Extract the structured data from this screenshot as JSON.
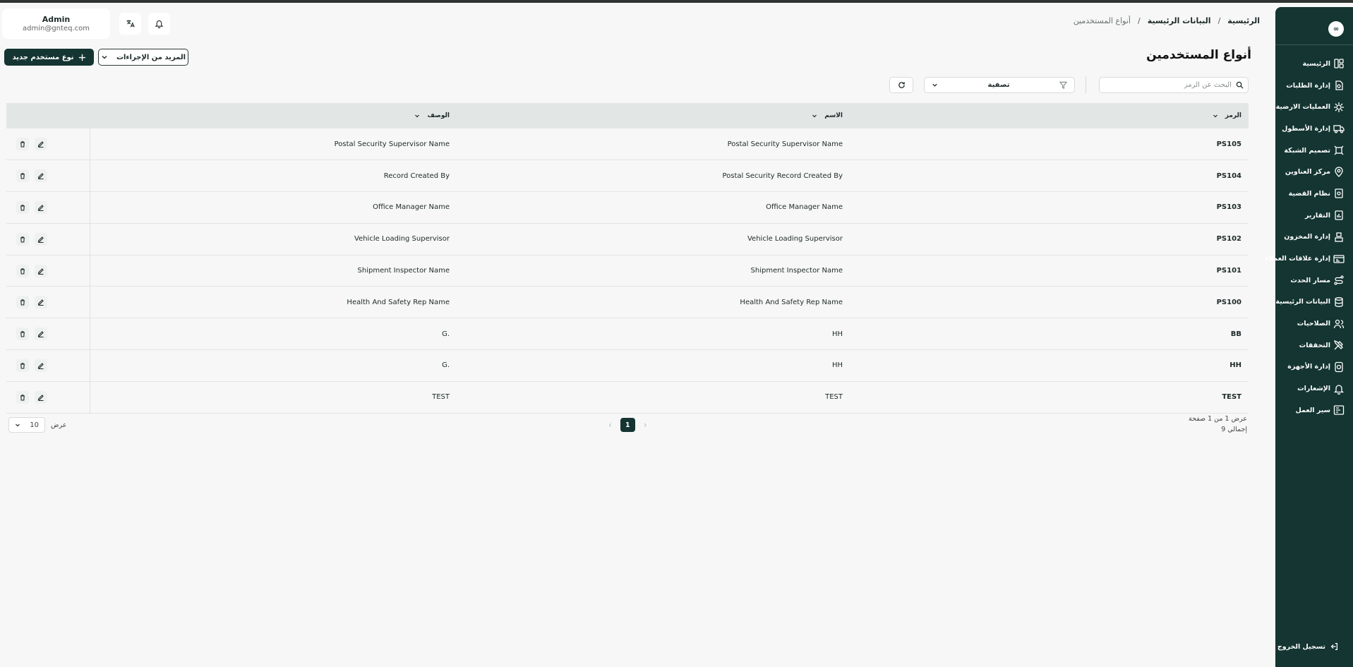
{
  "header": {
    "breadcrumb": {
      "home": "الرئيسية",
      "master_data": "البيانات الرئيسية",
      "current": "أنواع المستخدمين",
      "separator": "/"
    },
    "user": {
      "name": "Admin",
      "email": "admin@gnteq.com"
    }
  },
  "sidebar": {
    "logo": "∞",
    "items": [
      {
        "label": "الرئيسية",
        "icon": "layout-icon"
      },
      {
        "label": "إدارة الطلبات",
        "icon": "orders-icon"
      },
      {
        "label": "العمليات الارضية",
        "icon": "ground-ops-icon"
      },
      {
        "label": "إدارة الأسطول",
        "icon": "truck-icon"
      },
      {
        "label": "تصميم الشبكة",
        "icon": "network-icon"
      },
      {
        "label": "مركز العناوين",
        "icon": "location-icon"
      },
      {
        "label": "نظام القضية",
        "icon": "case-icon"
      },
      {
        "label": "التقارير",
        "icon": "report-icon"
      },
      {
        "label": "إدارة المخزون",
        "icon": "inventory-icon"
      },
      {
        "label": "إدارة علاقات العملاء",
        "icon": "crm-icon"
      },
      {
        "label": "مسار الحدث",
        "icon": "route-icon"
      },
      {
        "label": "البيانات الرئيسية",
        "icon": "database-icon"
      },
      {
        "label": "الصلاحيات",
        "icon": "users-icon"
      },
      {
        "label": "التحققات",
        "icon": "tools-icon"
      },
      {
        "label": "إدارة الأجهزة",
        "icon": "devices-icon"
      },
      {
        "label": "الإشعارات",
        "icon": "bell-icon"
      },
      {
        "label": "سير العمل",
        "icon": "workflow-icon"
      }
    ],
    "logout": "تسجيل الخروج"
  },
  "page": {
    "title": "أنواع المستخدمين",
    "new_button": "نوع مستخدم جديد",
    "more_actions": "المزيد من الإجراءات"
  },
  "toolbar": {
    "search_placeholder": "البحث عن الرمز",
    "filter_label": "تصفية"
  },
  "table": {
    "columns": {
      "code": "الرمز",
      "name": "الاسم",
      "description": "الوصف"
    },
    "rows": [
      {
        "code": "PS105",
        "name": "Postal Security Supervisor Name",
        "description": "Postal Security Supervisor Name"
      },
      {
        "code": "PS104",
        "name": "Postal Security Record Created By",
        "description": "Record Created By"
      },
      {
        "code": "PS103",
        "name": "Office Manager Name",
        "description": "Office Manager Name"
      },
      {
        "code": "PS102",
        "name": "Vehicle Loading Supervisor",
        "description": "Vehicle Loading Supervisor"
      },
      {
        "code": "PS101",
        "name": "Shipment Inspector Name",
        "description": "Shipment Inspector Name"
      },
      {
        "code": "PS100",
        "name": "Health And Safety Rep Name",
        "description": "Health And Safety Rep Name"
      },
      {
        "code": "BB",
        "name": "HH",
        "description": ".G"
      },
      {
        "code": "HH",
        "name": "HH",
        "description": ".G"
      },
      {
        "code": "TEST",
        "name": "TEST",
        "description": "TEST"
      }
    ]
  },
  "pagination": {
    "info": "عرض 1 من 1 صفحة",
    "total": "إجمالي 9",
    "current_page": "1",
    "prev": "‹",
    "next": "›",
    "show_label": "عرض",
    "page_size": "10"
  },
  "colors": {
    "sidebar_bg": "#143532",
    "accent": "#143532",
    "page_bg": "#f6f7f6",
    "table_header_bg": "#e2e6e5"
  }
}
